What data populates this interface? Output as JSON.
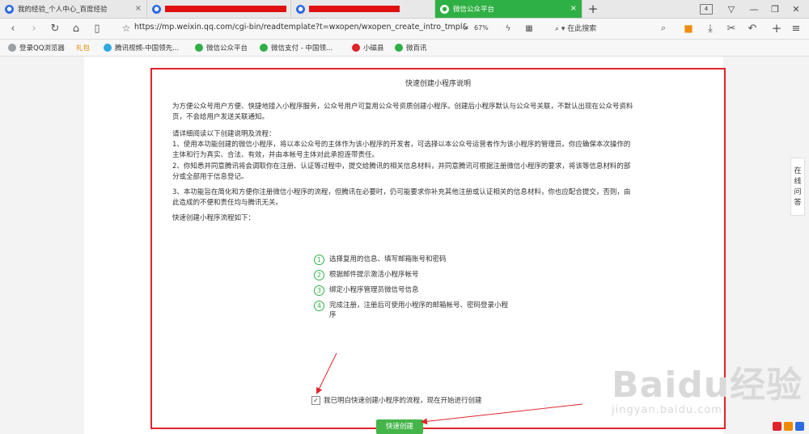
{
  "tabs": [
    {
      "label": "我的经验_个人中心_百度经验",
      "active": false,
      "redacted": false
    },
    {
      "label": "",
      "active": false,
      "redacted": true
    },
    {
      "label": "",
      "active": false,
      "redacted": true
    },
    {
      "label": "微信公众平台",
      "active": true,
      "redacted": false
    }
  ],
  "tab_count": "4",
  "toolbar": {
    "url": "https://mp.weixin.qq.com/cgi-bin/readtemplate?t=wxopen/wxopen_create_intro_tmpl&",
    "zoom": "67%",
    "search_placeholder": "在此搜索"
  },
  "bookmarks": [
    {
      "label": "登录QQ浏览器",
      "color": "#9aa0a6"
    },
    {
      "label": "礼包",
      "color": ""
    },
    {
      "label": "腾讯视频-中国领先...",
      "color": "#2fa8e0"
    },
    {
      "label": "微信公众平台",
      "color": "#2fb044"
    },
    {
      "label": "微信支付 - 中国领...",
      "color": "#2fb044"
    },
    {
      "label": "小磁县",
      "color": "#e0242a"
    },
    {
      "label": "微百讯",
      "color": "#2fb044"
    }
  ],
  "page": {
    "title": "快速创建小程序说明",
    "intro": "为方便公众号用户方便、快捷地接入小程序服务，公众号用户可复用公众号资质创建小程序。创建后小程序默认与公众号关联，不默认出现在公众号资料页，不会给用户发送关联通知。",
    "read_heading": "请详细阅读以下创建说明及流程：",
    "rule1": "1、使用本功能创建的微信小程序，将以本公众号的主体作为该小程序的开发者，可选择以本公众号运营者作为该小程序的管理员。你应确保本次操作的主体和行为真实、合法、有效，并由本帐号主体对此承担连带责任。",
    "rule2": "2、你知悉并同意腾讯将会调取你在注册、认证等过程中，提交给腾讯的相关信息材料，并同意腾讯可根据注册微信小程序的要求，将该等信息材料的部分或全部用于信息登记。",
    "rule3": "3、本功能旨在简化和方便你注册微信小程序的流程，但腾讯在必要时，仍可能要求你补充其他注册或认证相关的信息材料，你也应配合提交，否则，由此造成的不便和责任均与腾讯无关。",
    "flow_heading": "快速创建小程序流程如下：",
    "steps": [
      {
        "num": "1",
        "text": "选择复用的信息、填写邮箱账号和密码"
      },
      {
        "num": "2",
        "text": "根据邮件提示激活小程序帐号"
      },
      {
        "num": "3",
        "text": "绑定小程序管理员微信号信息"
      },
      {
        "num": "4",
        "text": "完成注册，注册后可使用小程序的邮箱帐号、密码登录小程序"
      }
    ],
    "agree_text": "我已明白快速创建小程序的流程，现在开始进行创建",
    "agree_checked": "✓",
    "button": "快速创建"
  },
  "feedback": [
    "在",
    "线",
    "问",
    "答"
  ],
  "watermark": {
    "line1": "Baidu经验",
    "line2": "jingyan.baidu.com"
  }
}
